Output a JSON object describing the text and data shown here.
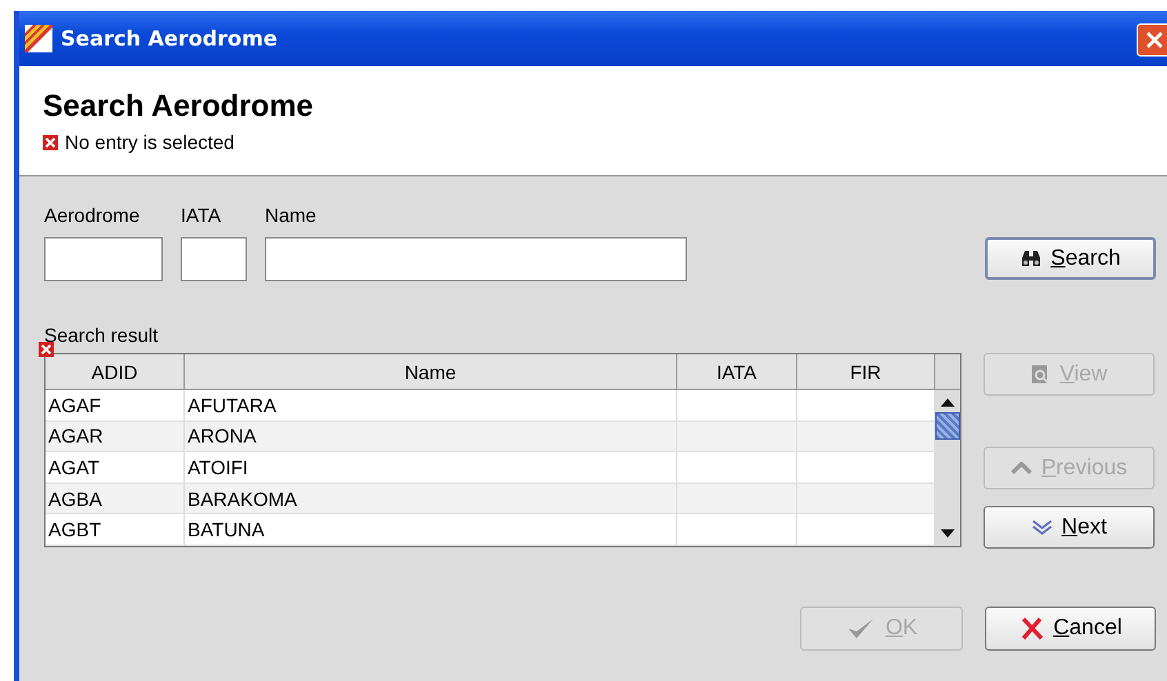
{
  "window": {
    "title": "Search Aerodrome"
  },
  "header": {
    "title": "Search Aerodrome",
    "status": "No entry is selected",
    "status_error": true
  },
  "fields": [
    {
      "label": "Aerodrome"
    },
    {
      "label": "IATA"
    },
    {
      "label": "Name"
    }
  ],
  "search_button": {
    "label": "Search",
    "disabled": false
  },
  "results": {
    "label": "Search result",
    "error": true,
    "columns": [
      "ADID",
      "Name",
      "IATA",
      "FIR"
    ],
    "rows": [
      [
        "AGAF",
        "AFUTARA",
        "",
        ""
      ],
      [
        "AGAR",
        "ARONA",
        "",
        ""
      ],
      [
        "AGAT",
        "ATOIFI",
        "",
        ""
      ],
      [
        "AGBA",
        "BARAKOMA",
        "",
        ""
      ],
      [
        "AGBT",
        "BATUNA",
        "",
        ""
      ]
    ]
  },
  "side_buttons": [
    {
      "kind": "view",
      "label": "View",
      "disabled": true
    },
    {
      "kind": "previous",
      "label": "Previous",
      "disabled": true
    },
    {
      "kind": "next",
      "label": "Next",
      "disabled": false
    }
  ],
  "footer_buttons": [
    {
      "kind": "ok",
      "label": "OK",
      "disabled": true
    },
    {
      "kind": "cancel",
      "label": "Cancel",
      "disabled": false
    }
  ]
}
